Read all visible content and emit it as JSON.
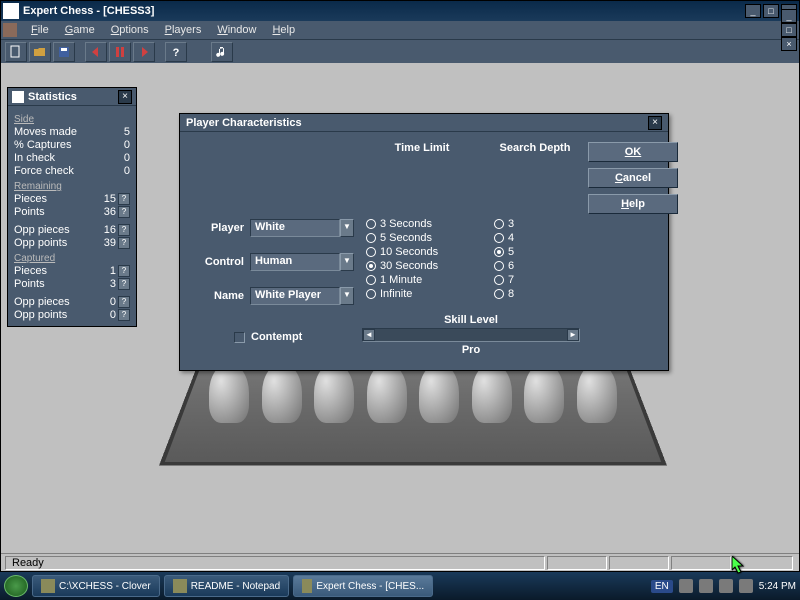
{
  "app": {
    "title": "Expert Chess - [CHESS3]",
    "menus": [
      "File",
      "Game",
      "Options",
      "Players",
      "Window",
      "Help"
    ]
  },
  "statusbar": {
    "text": "Ready"
  },
  "stats": {
    "title": "Statistics",
    "side_label": "Side",
    "rows1": [
      {
        "label": "Moves made",
        "value": "5"
      },
      {
        "label": "% Captures",
        "value": "0"
      },
      {
        "label": "In check",
        "value": "0"
      },
      {
        "label": "Force check",
        "value": "0"
      }
    ],
    "remaining_label": "Remaining",
    "rows2": [
      {
        "label": "Pieces",
        "value": "15",
        "q": true
      },
      {
        "label": "Points",
        "value": "36",
        "q": true
      }
    ],
    "rows3": [
      {
        "label": "Opp pieces",
        "value": "16",
        "q": true
      },
      {
        "label": "Opp points",
        "value": "39",
        "q": true
      }
    ],
    "captured_label": "Captured",
    "rows4": [
      {
        "label": "Pieces",
        "value": "1",
        "q": true
      },
      {
        "label": "Points",
        "value": "3",
        "q": true
      }
    ],
    "rows5": [
      {
        "label": "Opp pieces",
        "value": "0",
        "q": true
      },
      {
        "label": "Opp points",
        "value": "0",
        "q": true
      }
    ]
  },
  "dialog": {
    "title": "Player Characteristics",
    "player_label": "Player",
    "player_value": "White",
    "control_label": "Control",
    "control_value": "Human",
    "name_label": "Name",
    "name_value": "White Player",
    "timelimit_label": "Time Limit",
    "timelimit_options": [
      "3 Seconds",
      "5 Seconds",
      "10 Seconds",
      "30 Seconds",
      "1 Minute",
      "Infinite"
    ],
    "timelimit_selected": 3,
    "depth_label": "Search Depth",
    "depth_options": [
      "3",
      "4",
      "5",
      "6",
      "7",
      "8"
    ],
    "depth_selected": 2,
    "contempt_label": "Contempt",
    "skill_label": "Skill Level",
    "skill_value": "Pro",
    "ok": "OK",
    "cancel": "Cancel",
    "help": "Help"
  },
  "taskbar": {
    "items": [
      {
        "label": "C:\\XCHESS - Clover"
      },
      {
        "label": "README - Notepad"
      },
      {
        "label": "Expert Chess - [CHES..."
      }
    ],
    "lang": "EN",
    "time": "5:24 PM"
  }
}
